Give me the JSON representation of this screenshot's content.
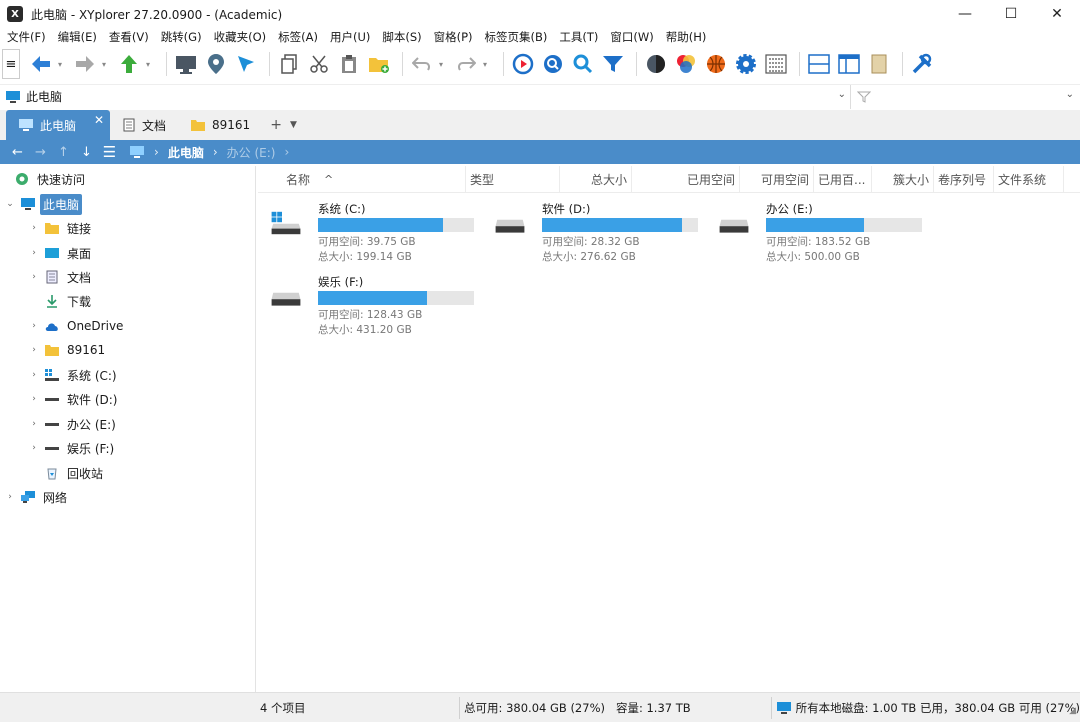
{
  "window": {
    "title": "此电脑 - XYplorer 27.20.0900 - (Academic)",
    "logo_text": "X",
    "minimize": "—",
    "maximize": "☐",
    "close": "✕"
  },
  "menu": [
    "文件(F)",
    "编辑(E)",
    "查看(V)",
    "跳转(G)",
    "收藏夹(O)",
    "标签(A)",
    "用户(U)",
    "脚本(S)",
    "窗格(P)",
    "标签页集(B)",
    "工具(T)",
    "窗口(W)",
    "帮助(H)"
  ],
  "toolbar": {
    "menu_grip": "≡",
    "icons": [
      "back-icon",
      "forward-icon",
      "up-icon",
      "computer-icon",
      "location-pin-icon",
      "select-cursor-icon",
      "copy-icon",
      "cut-icon",
      "paste-icon",
      "new-folder-icon",
      "undo-icon",
      "redo-icon",
      "play-icon",
      "search-icon",
      "find-files-icon",
      "filter-icon",
      "theme-icon",
      "color-filter-icon",
      "basketball-icon",
      "settings-gear-icon",
      "grid-view-icon",
      "horizontal-panes-icon",
      "dual-pane-icon",
      "info-panel-icon",
      "tools-icon"
    ]
  },
  "address": {
    "text": "此电脑",
    "dropdown": "⌄",
    "filter_placeholder": ""
  },
  "tabs": [
    {
      "label": "此电脑",
      "icon": "computer-icon",
      "close": "✕"
    },
    {
      "label": "文档",
      "icon": "document-icon"
    },
    {
      "label": "89161",
      "icon": "folder-icon"
    }
  ],
  "tab_add": "+",
  "tab_menu": "▼",
  "breadcrumb": {
    "items": [
      "此电脑",
      "办公 (E:)"
    ]
  },
  "tree": [
    {
      "label": "快速访问",
      "icon": "quick-access-icon",
      "arrow": "",
      "level": 0
    },
    {
      "label": "此电脑",
      "icon": "computer-icon",
      "arrow": "⌄",
      "level": 0,
      "selected": true
    },
    {
      "label": "链接",
      "icon": "folder-icon",
      "arrow": "›",
      "level": 1
    },
    {
      "label": "桌面",
      "icon": "desktop-icon",
      "arrow": "›",
      "level": 1
    },
    {
      "label": "文档",
      "icon": "document-icon",
      "arrow": "›",
      "level": 1
    },
    {
      "label": "下载",
      "icon": "download-icon",
      "arrow": "",
      "level": 1
    },
    {
      "label": "OneDrive",
      "icon": "cloud-icon",
      "arrow": "›",
      "level": 1
    },
    {
      "label": "89161",
      "icon": "folder-icon",
      "arrow": "›",
      "level": 1
    },
    {
      "label": "系统 (C:)",
      "icon": "windows-drive-icon",
      "arrow": "›",
      "level": 1
    },
    {
      "label": "软件 (D:)",
      "icon": "drive-icon",
      "arrow": "›",
      "level": 1
    },
    {
      "label": "办公 (E:)",
      "icon": "drive-icon",
      "arrow": "›",
      "level": 1
    },
    {
      "label": "娱乐 (F:)",
      "icon": "drive-icon",
      "arrow": "›",
      "level": 1
    },
    {
      "label": "回收站",
      "icon": "recycle-bin-icon",
      "arrow": "",
      "level": 1
    },
    {
      "label": "网络",
      "icon": "network-icon",
      "arrow": "›",
      "level": 0
    }
  ],
  "columns": [
    "名称",
    "类型",
    "总大小",
    "已用空间",
    "可用空间",
    "已用百...",
    "簇大小",
    "卷序列号",
    "文件系统"
  ],
  "sort_indicator": "^",
  "drives": [
    {
      "name": "系统 (C:)",
      "free": "可用空间: 39.75 GB",
      "total": "总大小: 199.14 GB",
      "used_fraction": 0.8,
      "icon": "windows-drive-icon"
    },
    {
      "name": "软件 (D:)",
      "free": "可用空间: 28.32 GB",
      "total": "总大小: 276.62 GB",
      "used_fraction": 0.9,
      "icon": "drive-icon"
    },
    {
      "name": "办公 (E:)",
      "free": "可用空间: 183.52 GB",
      "total": "总大小: 500.00 GB",
      "used_fraction": 0.63,
      "icon": "drive-icon"
    },
    {
      "name": "娱乐 (F:)",
      "free": "可用空间: 128.43 GB",
      "total": "总大小: 431.20 GB",
      "used_fraction": 0.7,
      "icon": "drive-icon"
    }
  ],
  "status": {
    "items": "4 个项目",
    "total": "总可用: 380.04 GB (27%)   容量: 1.37 TB",
    "disks": "所有本地磁盘: 1.00 TB 已用，380.04 GB 可用 (27%)",
    "resize": "◢"
  },
  "colors": {
    "accent": "#4a8cc9",
    "drive_bar": "#3aa0e6"
  }
}
